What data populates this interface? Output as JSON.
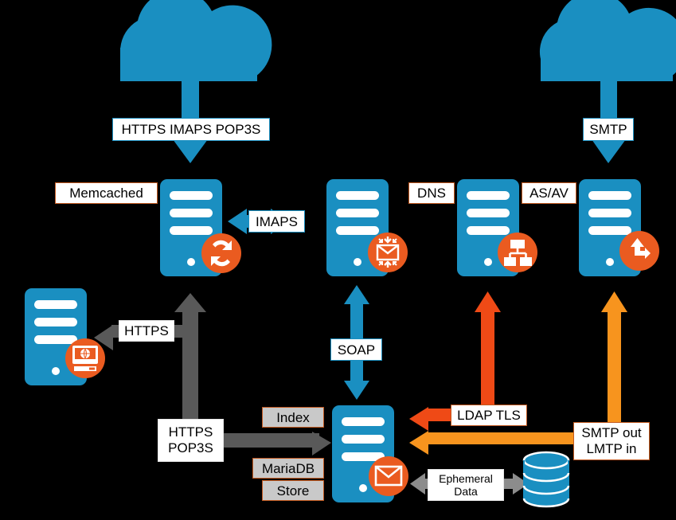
{
  "diagram": {
    "title": "Mail platform architecture",
    "background": "#000000",
    "colors": {
      "node_blue": "#1a8fc1",
      "badge_orange": "#ea5b20",
      "arrow_blue": "#1a8fc1",
      "arrow_gray": "#595959",
      "arrow_red_orange": "#ef4a16",
      "arrow_orange": "#f7941e",
      "label_fill": "#ffffff",
      "label_fill_gray": "#c9c9c9",
      "label_border_orange": "#c2591f",
      "label_border_gray": "#e6e6e6"
    }
  },
  "clouds": [
    {
      "name": "internet-cloud-left"
    },
    {
      "name": "internet-cloud-right"
    }
  ],
  "servers": [
    {
      "id": "proxy",
      "icon": "sync-icon",
      "row": "top"
    },
    {
      "id": "mailbox",
      "icon": "mail-in-icon",
      "row": "top"
    },
    {
      "id": "directory",
      "icon": "hierarchy-icon",
      "row": "top"
    },
    {
      "id": "mta",
      "icon": "route-icon",
      "row": "top"
    },
    {
      "id": "webclient",
      "icon": "web-globe-icon",
      "row": "middle-left"
    },
    {
      "id": "mailstore",
      "icon": "envelope-icon",
      "row": "bottom"
    }
  ],
  "database": {
    "id": "ephemeral-db",
    "icon": "database-cylinder-icon"
  },
  "labels": {
    "https_imaps_pop3s": "HTTPS IMAPS POP3S",
    "smtp": "SMTP",
    "memcached": "Memcached",
    "imaps": "IMAPS",
    "dns": "DNS",
    "as_av": "AS/AV",
    "https": "HTTPS",
    "soap": "SOAP",
    "https_pop3s": "HTTPS\nPOP3S",
    "index": "Index",
    "mariadb": "MariaDB",
    "store": "Store",
    "ldap_tls": "LDAP TLS",
    "smtp_out_lmtp_in": "SMTP out\nLMTP in",
    "ephemeral_data": "Ephemeral\nData"
  },
  "connections": [
    {
      "name": "cloud-left-to-proxy",
      "label": "HTTPS IMAPS POP3S",
      "color": "#1a8fc1",
      "direction": "down"
    },
    {
      "name": "cloud-right-to-mta",
      "label": "SMTP",
      "color": "#1a8fc1",
      "direction": "down"
    },
    {
      "name": "proxy-to-mailbox",
      "label": "IMAPS",
      "color": "#1a8fc1",
      "direction": "both"
    },
    {
      "name": "mailbox-to-mailstore",
      "label": "SOAP",
      "color": "#1a8fc1",
      "direction": "both"
    },
    {
      "name": "mailstore-to-webclient",
      "label": "HTTPS",
      "color": "#595959",
      "direction": "left"
    },
    {
      "name": "mailstore-up-https-pop3s",
      "label": "HTTPS POP3S",
      "color": "#595959",
      "direction": "up"
    },
    {
      "name": "mailstore-index-mariadb",
      "label": "Index MariaDB Store",
      "color": "#595959",
      "direction": "right"
    },
    {
      "name": "directory-to-mailstore",
      "label": "LDAP TLS",
      "color": "#ef4a16",
      "direction": "left"
    },
    {
      "name": "mta-to-mailstore",
      "label": "SMTP out LMTP in",
      "color": "#f7941e",
      "direction": "left"
    },
    {
      "name": "mailstore-to-database",
      "label": "Ephemeral Data",
      "color": "#888888",
      "direction": "both"
    }
  ]
}
